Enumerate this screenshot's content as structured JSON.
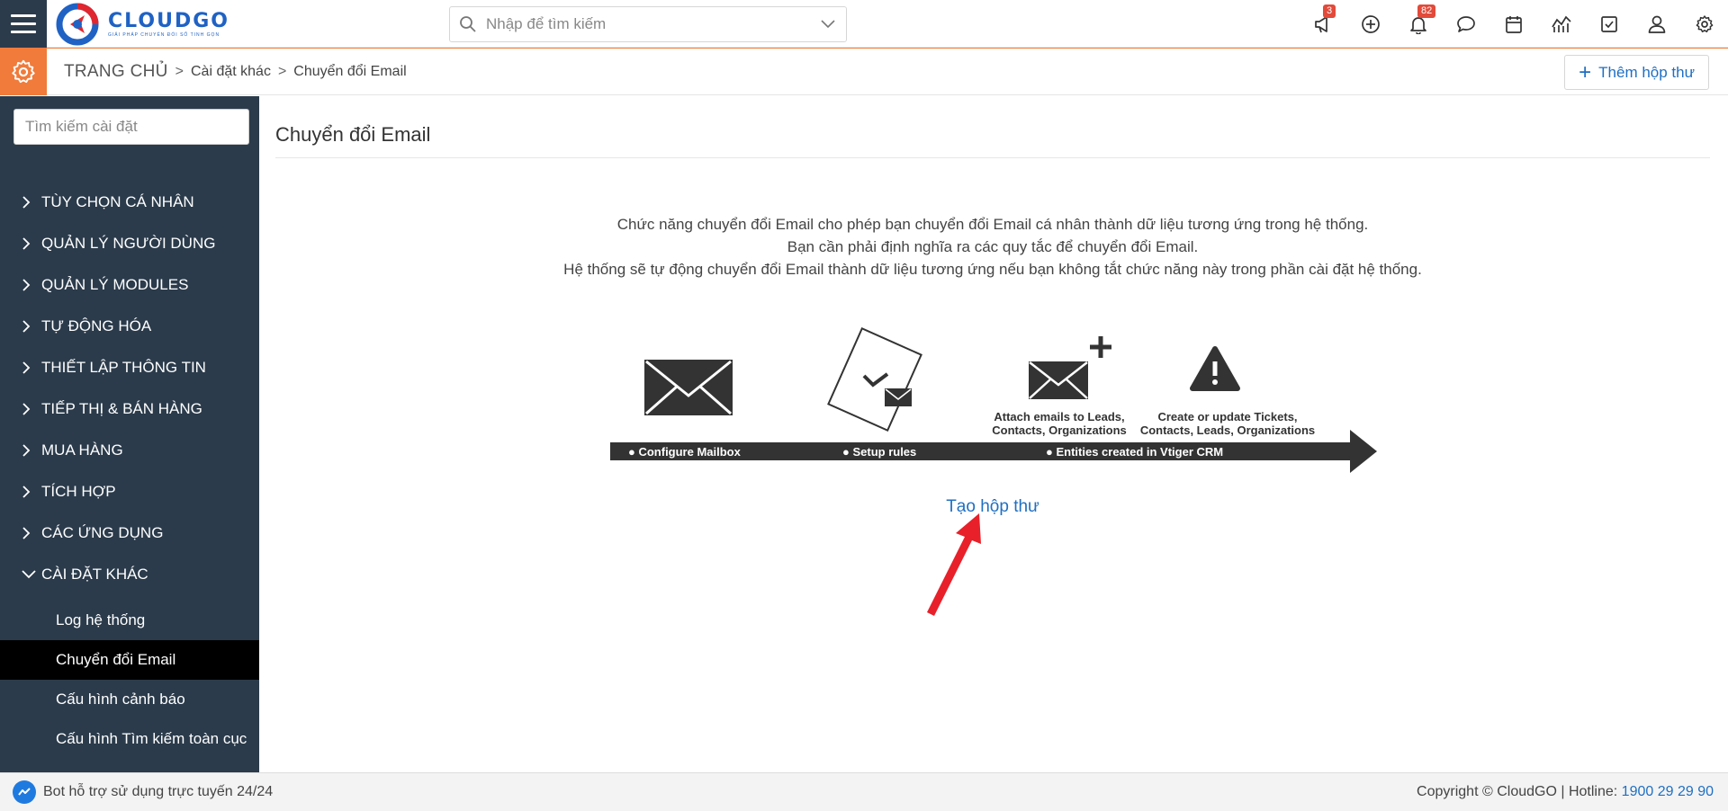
{
  "header": {
    "brand": "CLOUDGO",
    "brand_tagline": "GIẢI PHÁP CHUYỂN ĐỔI SỐ TINH GỌN",
    "search_placeholder": "Nhập để tìm kiếm",
    "icons": [
      {
        "name": "megaphone-icon",
        "badge": "3"
      },
      {
        "name": "plus-circle-icon",
        "badge": null
      },
      {
        "name": "bell-icon",
        "badge": "82"
      },
      {
        "name": "chat-icon",
        "badge": null
      },
      {
        "name": "calendar-icon",
        "badge": null
      },
      {
        "name": "chart-icon",
        "badge": null
      },
      {
        "name": "checkbox-icon",
        "badge": null
      },
      {
        "name": "user-icon",
        "badge": null
      },
      {
        "name": "settings-icon",
        "badge": null
      }
    ]
  },
  "breadcrumb": {
    "home": "TRANG CHỦ",
    "level1": "Cài đặt khác",
    "level2": "Chuyển đổi Email",
    "separator": ">",
    "add_button": "Thêm hộp thư"
  },
  "sidebar": {
    "search_placeholder": "Tìm kiếm cài đặt",
    "items": [
      {
        "label": "TÙY CHỌN CÁ NHÂN",
        "expanded": false
      },
      {
        "label": "QUẢN LÝ NGƯỜI DÙNG",
        "expanded": false
      },
      {
        "label": "QUẢN LÝ MODULES",
        "expanded": false
      },
      {
        "label": "TỰ ĐỘNG HÓA",
        "expanded": false
      },
      {
        "label": "THIẾT LẬP THÔNG TIN",
        "expanded": false
      },
      {
        "label": "TIẾP THỊ & BÁN HÀNG",
        "expanded": false
      },
      {
        "label": "MUA HÀNG",
        "expanded": false
      },
      {
        "label": "TÍCH HỢP",
        "expanded": false
      },
      {
        "label": "CÁC ỨNG DỤNG",
        "expanded": false
      },
      {
        "label": "CÀI ĐẶT KHÁC",
        "expanded": true
      }
    ],
    "sub_items": [
      {
        "label": "Log hệ thống",
        "active": false
      },
      {
        "label": "Chuyển đổi Email",
        "active": true
      },
      {
        "label": "Cấu hình cảnh báo",
        "active": false
      },
      {
        "label": "Cấu hình Tìm kiếm toàn cục",
        "active": false
      }
    ]
  },
  "main": {
    "title": "Chuyển đổi Email",
    "description": [
      "Chức năng chuyển đổi Email cho phép bạn chuyển đổi Email cá nhân thành dữ liệu tương ứng trong hệ thống.",
      "Bạn cần phải định nghĩa ra các quy tắc để chuyển đổi Email.",
      "Hệ thống sẽ tự động chuyển đổi Email thành dữ liệu tương ứng nếu bạn không tắt chức năng này trong phần cài đặt hệ thống."
    ],
    "illustration": {
      "caption_attach_1": "Attach emails to Leads,",
      "caption_attach_2": "Contacts, Organizations",
      "caption_update_1": "Create or update Tickets,",
      "caption_update_2": "Contacts, Leads, Organizations",
      "step1": "● Configure Mailbox",
      "step2": "● Setup rules",
      "step3": "● Entities created in Vtiger CRM"
    },
    "create_link": "Tạo hộp thư"
  },
  "footer": {
    "bot_text": "Bot hỗ trợ sử dụng trực tuyến 24/24",
    "copyright": "Copyright © CloudGO",
    "hotline_label": "Hotline:",
    "hotline_number": "1900 29 29 90"
  },
  "colors": {
    "sidebar_bg": "#2b3b4b",
    "accent_orange": "#f07b3a",
    "link_blue": "#1f6fc2",
    "badge_red": "#e24a3a",
    "active_item_bg": "#000000"
  }
}
